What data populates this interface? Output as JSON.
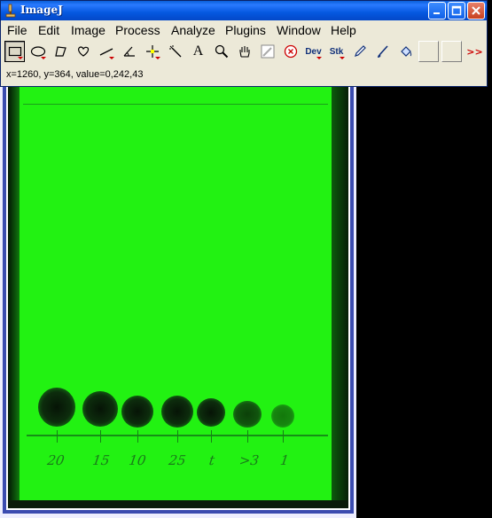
{
  "window": {
    "title": "ImageJ"
  },
  "menu": [
    "File",
    "Edit",
    "Image",
    "Process",
    "Analyze",
    "Plugins",
    "Window",
    "Help"
  ],
  "toolbar": {
    "tools": [
      {
        "name": "rectangle-tool-icon",
        "selected": true
      },
      {
        "name": "oval-tool-icon"
      },
      {
        "name": "polygon-tool-icon"
      },
      {
        "name": "freehand-tool-icon"
      },
      {
        "name": "line-tool-icon"
      },
      {
        "name": "angle-tool-icon"
      },
      {
        "name": "point-tool-icon"
      },
      {
        "name": "wand-tool-icon"
      },
      {
        "name": "text-tool-icon",
        "label": "A"
      },
      {
        "name": "magnifier-tool-icon"
      },
      {
        "name": "hand-tool-icon"
      },
      {
        "name": "dropper-tool-icon"
      },
      {
        "name": "close-roi-tool-icon"
      },
      {
        "name": "dev-menu-tool",
        "label": "Dev"
      },
      {
        "name": "stk-menu-tool",
        "label": "Stk"
      },
      {
        "name": "pencil-tool-icon"
      },
      {
        "name": "brush-tool-icon"
      },
      {
        "name": "flood-fill-tool-icon"
      }
    ],
    "more_label": ">>"
  },
  "status": "x=1260, y=364, value=0,242,43",
  "image": {
    "lane_labels": [
      "20",
      "15",
      "10",
      "25",
      "t",
      ">3",
      "1"
    ],
    "plate_color": "#22f212"
  }
}
